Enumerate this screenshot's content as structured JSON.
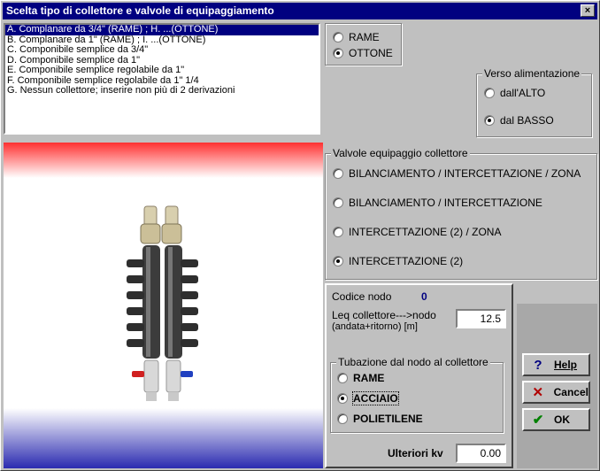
{
  "window": {
    "title": "Scelta tipo di collettore e valvole di equipaggiamento",
    "close_glyph": "×"
  },
  "collector_list": {
    "items": [
      "A. Complanare da 3/4\" (RAME)    ; H. ...(OTTONE)",
      "B. Complanare da 1\" (RAME)    ; I. ...(OTTONE)",
      "C. Componibile semplice da 3/4\"",
      "D. Componibile semplice da 1\"",
      "E. Componibile semplice regolabile da 1\"",
      "F. Componibile semplice regolabile da 1\" 1/4",
      "G. Nessun collettore; inserire non più di 2 derivazioni"
    ],
    "selected_index": 0
  },
  "material": {
    "options": [
      "RAME",
      "OTTONE"
    ],
    "selected": "OTTONE"
  },
  "verso": {
    "legend": "Verso alimentazione",
    "options": [
      "dall'ALTO",
      "dal BASSO"
    ],
    "selected": "dal BASSO"
  },
  "valvole": {
    "legend": "Valvole equipaggio collettore",
    "options": [
      "BILANCIAMENTO / INTERCETTAZIONE / ZONA",
      "BILANCIAMENTO / INTERCETTAZIONE",
      "INTERCETTAZIONE (2) / ZONA",
      "INTERCETTAZIONE (2)"
    ],
    "selected": "INTERCETTAZIONE (2)"
  },
  "nodo": {
    "codice_label": "Codice nodo",
    "codice_value": "0",
    "leq_label_1": "Leq collettore--->nodo",
    "leq_label_2": "(andata+ritorno)  [m]",
    "leq_value": "12.5"
  },
  "tubazione": {
    "legend": "Tubazione dal nodo al collettore",
    "options": [
      "RAME",
      "ACCIAIO",
      "POLIETILENE"
    ],
    "selected": "ACCIAIO"
  },
  "ulteriori": {
    "label": "Ulteriori kv",
    "value": "0.00"
  },
  "buttons": {
    "help": {
      "label": "Help",
      "icon": "question-icon",
      "glyph": "?",
      "color": "#000080"
    },
    "cancel": {
      "label": "Cancel",
      "icon": "x-icon",
      "glyph": "✕",
      "color": "#b00000"
    },
    "ok": {
      "label": "OK",
      "icon": "check-icon",
      "glyph": "✔",
      "color": "#008000"
    }
  }
}
